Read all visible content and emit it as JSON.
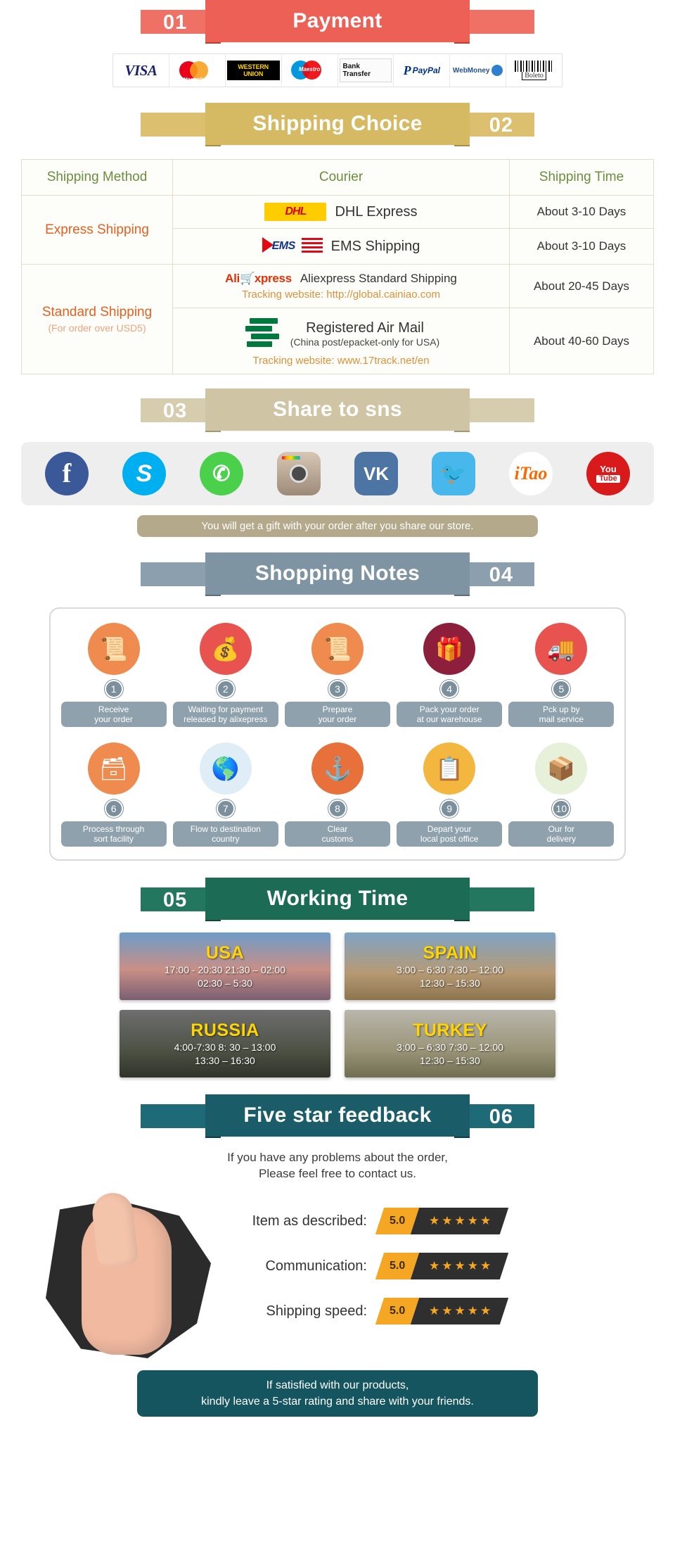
{
  "sections": {
    "payment": {
      "number": "01",
      "title": "Payment"
    },
    "shipping": {
      "number": "02",
      "title": "Shipping Choice"
    },
    "share": {
      "number": "03",
      "title": "Share to sns"
    },
    "notes": {
      "number": "04",
      "title": "Shopping Notes"
    },
    "working": {
      "number": "05",
      "title": "Working Time"
    },
    "feedback": {
      "number": "06",
      "title": "Five star feedback"
    }
  },
  "payment_methods": [
    {
      "name": "visa",
      "label": "VISA"
    },
    {
      "name": "mastercard",
      "label": "MasterCard"
    },
    {
      "name": "western-union",
      "label": "WESTERN UNION"
    },
    {
      "name": "maestro",
      "label": "Maestro"
    },
    {
      "name": "bank-transfer",
      "label": "Bank Transfer"
    },
    {
      "name": "paypal",
      "label": "PayPal"
    },
    {
      "name": "webmoney",
      "label": "WebMoney"
    },
    {
      "name": "boleto",
      "label": "Boleto"
    }
  ],
  "shipping_table": {
    "headers": [
      "Shipping Method",
      "Courier",
      "Shipping Time"
    ],
    "rows": [
      {
        "method": "Express Shipping",
        "method_sub": "",
        "courier": "DHL Express",
        "courier_sub": "",
        "tracking": "",
        "time": "About 3-10 Days",
        "logo": "dhl-logo"
      },
      {
        "method": "",
        "method_sub": "",
        "courier": "EMS Shipping",
        "courier_sub": "",
        "tracking": "",
        "time": "About 3-10 Days",
        "logo": "ems-logo"
      },
      {
        "method": "Standard Shipping",
        "method_sub": "(For order over USD5)",
        "courier": "Aliexpress Standard Shipping",
        "courier_sub": "",
        "tracking": "Tracking website: http://global.cainiao.com",
        "time": "About 20-45 Days",
        "logo": "aliexpress-logo"
      },
      {
        "method": "",
        "method_sub": "",
        "courier": "Registered Air Mail",
        "courier_sub": "(China post/epacket-only for USA)",
        "tracking": "Tracking website: www.17track.net/en",
        "time": "About 40-60 Days",
        "logo": "china-post-logo"
      }
    ]
  },
  "social": {
    "icons": [
      {
        "name": "facebook-icon",
        "glyph": "f"
      },
      {
        "name": "skype-icon",
        "glyph": "S"
      },
      {
        "name": "whatsapp-icon",
        "glyph": "✆"
      },
      {
        "name": "instagram-icon",
        "glyph": ""
      },
      {
        "name": "vk-icon",
        "glyph": "VK"
      },
      {
        "name": "twitter-icon",
        "glyph": "ὂ6"
      },
      {
        "name": "itao-icon",
        "glyph": "iTao"
      },
      {
        "name": "youtube-icon",
        "glyph": "You"
      }
    ],
    "youtube_sub": "Tube",
    "gift_note": "You will get a gift with your order after you share our store."
  },
  "shopping_notes": {
    "steps": [
      {
        "num": "1",
        "label": "Receive\nyour order",
        "icon": "document-icon",
        "color": "#ef8b4e"
      },
      {
        "num": "2",
        "label": "Waiting for payment\nreleased by alixepress",
        "icon": "money-bag-icon",
        "color": "#e8534f"
      },
      {
        "num": "3",
        "label": "Prepare\nyour order",
        "icon": "document-icon",
        "color": "#ef8b4e"
      },
      {
        "num": "4",
        "label": "Pack your order\nat our warehouse",
        "icon": "gift-icon",
        "color": "#8e1f3c"
      },
      {
        "num": "5",
        "label": "Pck up by\nmail service",
        "icon": "mail-truck-icon",
        "color": "#e8534f"
      },
      {
        "num": "6",
        "label": "Process through\nsort facility",
        "icon": "sort-icon",
        "color": "#ef8b4e"
      },
      {
        "num": "7",
        "label": "Flow to destination\ncountry",
        "icon": "globe-icon",
        "color": "#dfeef6"
      },
      {
        "num": "8",
        "label": "Clear\ncustoms",
        "icon": "anchor-icon",
        "color": "#e8703a"
      },
      {
        "num": "9",
        "label": "Depart your\nlocal post office",
        "icon": "clipboard-icon",
        "color": "#f3b63f"
      },
      {
        "num": "10",
        "label": "Our for\ndelivery",
        "icon": "parcel-icon",
        "color": "#e7f0d9"
      }
    ]
  },
  "working_time": {
    "cards": [
      {
        "country": "USA",
        "hours": "17:00 - 20:30  21:30 – 02:00\n02:30 – 5:30",
        "bg": "bg-usa"
      },
      {
        "country": "SPAIN",
        "hours": "3:00 – 6:30   7:30 – 12:00\n12:30 – 15:30",
        "bg": "bg-spain"
      },
      {
        "country": "RUSSIA",
        "hours": "4:00-7:30  8: 30 – 13:00\n13:30 – 16:30",
        "bg": "bg-russia"
      },
      {
        "country": "TURKEY",
        "hours": "3:00 – 6:30   7:30 – 12:00\n12:30 – 15:30",
        "bg": "bg-turkey"
      }
    ]
  },
  "feedback": {
    "intro": "If you have any problems about the order,\nPlease feel free to contact us.",
    "ratings": [
      {
        "label": "Item as described:",
        "score": "5.0",
        "stars": "★★★★★"
      },
      {
        "label": "Communication:",
        "score": "5.0",
        "stars": "★★★★★"
      },
      {
        "label": "Shipping speed:",
        "score": "5.0",
        "stars": "★★★★★"
      }
    ],
    "footer": "If satisfied with our products,\nkindly leave a 5-star rating and share with your friends."
  },
  "colors": {
    "payment_red": "#ec6055",
    "shipping_gold": "#d6b963",
    "share_khaki": "#cfc4a4",
    "notes_slate": "#7f94a3",
    "working_green": "#1c6b54",
    "feedback_teal": "#1a5c68",
    "star_orange": "#f5a623",
    "header_green": "#6b8e3d",
    "method_orange": "#e4601f"
  }
}
